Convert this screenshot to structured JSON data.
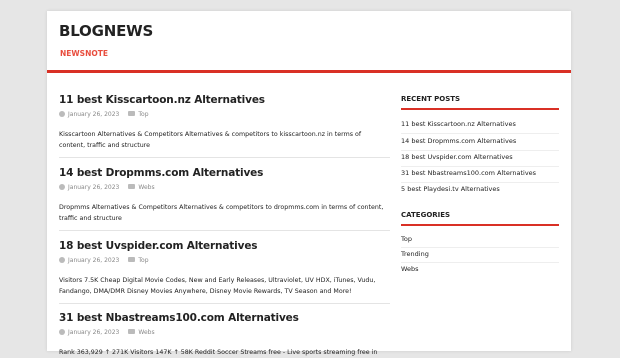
{
  "site": {
    "title": "BLOGNEWS",
    "tagline": "NEWSNOTE"
  },
  "posts": [
    {
      "title": "11 best Kisscartoon.nz Alternatives",
      "date": "January 26, 2023",
      "category": "Top",
      "excerpt": "Kisscartoon Alternatives & Competitors Alternatives & competitors to kisscartoon.nz in terms of content, traffic and structure"
    },
    {
      "title": "14 best Dropmms.com Alternatives",
      "date": "January 26, 2023",
      "category": "Webs",
      "excerpt": "Dropmms Alternatives & Competitors Alternatives & competitors to dropmms.com in terms of content, traffic and structure"
    },
    {
      "title": "18 best Uvspider.com Alternatives",
      "date": "January 26, 2023",
      "category": "Top",
      "excerpt": "Visitors 7.5K Cheap Digital Movie Codes, New and Early Releases, Ultraviolet, UV HDX, iTunes, Vudu, Fandango, DMA/DMR Disney Movies Anywhere, Disney Movie Rewards, TV Season and More!"
    },
    {
      "title": "31 best Nbastreams100.com Alternatives",
      "date": "January 26, 2023",
      "category": "Webs",
      "excerpt": "Rank 363,929 ↑ 271K Visitors 147K ↑ 58K Reddit Soccer Streams free - Live sports streaming free in"
    }
  ],
  "sidebar": {
    "recent_title": "RECENT POSTS",
    "recent_posts": [
      "11 best Kisscartoon.nz Alternatives",
      "14 best Dropmms.com Alternatives",
      "18 best Uvspider.com Alternatives",
      "31 best Nbastreams100.com Alternatives",
      "5 best Playdesi.tv Alternatives"
    ],
    "categories_title": "CATEGORIES",
    "categories": [
      "Top",
      "Trending",
      "Webs"
    ]
  },
  "colors": {
    "accent": "#d93025",
    "tagline": "#e84c3d",
    "background": "#e6e6e6"
  }
}
